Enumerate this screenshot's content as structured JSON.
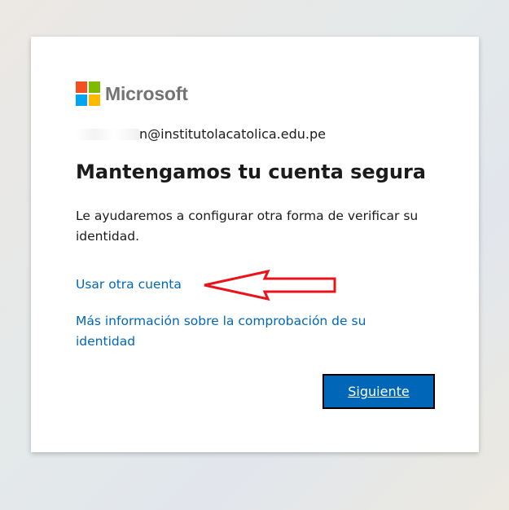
{
  "brand": {
    "name": "Microsoft",
    "logo_colors": [
      "#f25022",
      "#7fba00",
      "#00a4ef",
      "#ffb900"
    ]
  },
  "identity": {
    "email_visible": "n@institutolacatolica.edu.pe"
  },
  "page": {
    "title": "Mantengamos tu cuenta segura",
    "description": "Le ayudaremos a configurar otra forma de verificar su identidad."
  },
  "links": {
    "use_other_account": "Usar otra cuenta",
    "more_info": "Más información sobre la comprobación de su identidad"
  },
  "buttons": {
    "next": "Siguiente"
  },
  "colors": {
    "accent": "#0067b8",
    "annotation_arrow": "#e8141b"
  }
}
